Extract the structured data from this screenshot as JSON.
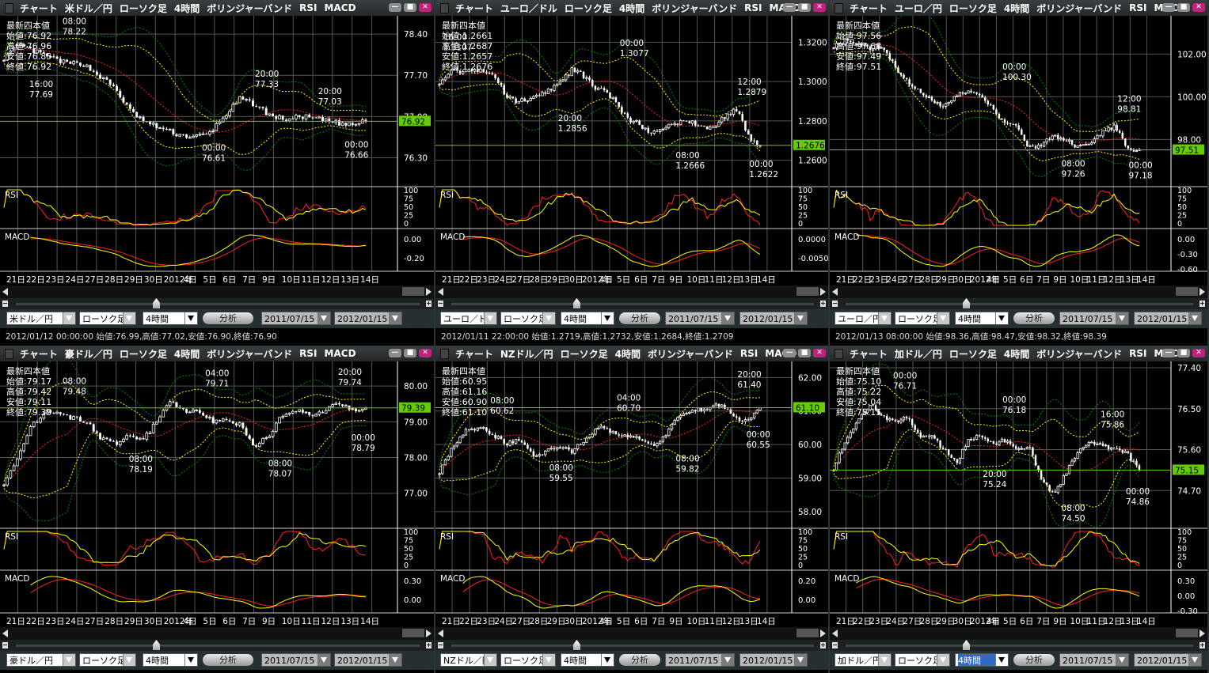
{
  "title_common": {
    "chart": "チャート",
    "type": "ローソク足",
    "interval": "4時間",
    "bb": "ボリンジャーバンド",
    "rsi": "RSI",
    "macd": "MACD"
  },
  "labels": {
    "latest": "最新四本値",
    "open": "始値:",
    "high": "高値:",
    "low": "安値:",
    "close": "終値:",
    "rsi": "RSI",
    "macd": "MACD",
    "analyze": "分析",
    "minimize": "—",
    "maximize": "■",
    "close_btn": "✕"
  },
  "colors": {
    "candle": "#ffffff",
    "bb_mid": "#ff2020",
    "bb_2s": "#ffff00",
    "bb_3s": "#008800",
    "current": "#66cc00",
    "rsi_a": "#ffff00",
    "rsi_b": "#ff2020",
    "macd": "#ffff00",
    "signal": "#ff2020",
    "grid": "#555555"
  },
  "date_labels": [
    "21日",
    "22日",
    "23日",
    "24日",
    "27日",
    "28日",
    "29日",
    "30日",
    "2012年",
    "4日",
    "5日",
    "6日",
    "7日",
    "9日",
    "10日",
    "11日",
    "12日",
    "13日",
    "14日"
  ],
  "rsi_ticks": [
    "100",
    "75",
    "50",
    "25",
    "0"
  ],
  "panels": [
    {
      "pair": "米ドル／円",
      "pair_select": "米ドル／円",
      "type_select": "ローソク足",
      "interval_select": "4時間",
      "interval_highlight": false,
      "date_from": "2011/07/15",
      "date_to": "2012/01/15",
      "ohlc": {
        "open": "76.92",
        "high": "76.96",
        "low": "76.85",
        "close": "76.92"
      },
      "current": "76.92",
      "ylim": [
        75.81,
        78.71
      ],
      "ticks": [
        "78.40",
        "77.70",
        "77.00",
        "76.30"
      ],
      "macd_ticks": [
        "0.00",
        "-0.20"
      ],
      "shape": [
        78.0,
        78.2,
        78.1,
        78.0,
        77.9,
        77.9,
        77.7,
        77.5,
        77.1,
        76.9,
        76.8,
        76.7,
        76.65,
        76.7,
        77.0,
        77.3,
        77.2,
        77.0,
        76.95,
        77.0,
        76.95,
        76.9,
        76.85,
        76.92
      ],
      "annotations": [
        {
          "time": "08:00",
          "price": "78.22",
          "at": 20,
          "kind": "high"
        },
        {
          "time": "16:00",
          "price": "77.69",
          "at": 10,
          "kind": "low"
        },
        {
          "time": "20:00",
          "price": "77.33",
          "at": 78,
          "kind": "high"
        },
        {
          "time": "20:00",
          "price": "77.03",
          "at": 97,
          "kind": "high"
        },
        {
          "time": "00:00",
          "price": "76.61",
          "at": 62,
          "kind": "low"
        },
        {
          "time": "00:00",
          "price": "76.66",
          "at": 105,
          "kind": "low"
        }
      ],
      "status": "2012/01/12 00:00:00 始値:76.99,高値:77.02,安値:76.90,終値:76.90"
    },
    {
      "pair": "ユーロ／ドル",
      "pair_select": "ユーロ／ドル",
      "type_select": "ローソク足",
      "interval_select": "4時間",
      "interval_highlight": false,
      "date_from": "2011/07/15",
      "date_to": "2012/01/15",
      "ohlc": {
        "open": "1.2661",
        "high": "1.2687",
        "low": "1.2657",
        "close": "1.2676"
      },
      "current": "1.2676",
      "ylim": [
        1.2466,
        1.3334
      ],
      "ticks": [
        "1.3200",
        "1.3000",
        "1.2800",
        "1.2600"
      ],
      "macd_ticks": [
        "0.0000",
        "-0.0050"
      ],
      "shape": [
        1.3,
        1.306,
        1.305,
        1.306,
        1.305,
        1.303,
        1.293,
        1.29,
        1.291,
        1.292,
        1.296,
        1.3,
        1.306,
        1.303,
        1.297,
        1.295,
        1.289,
        1.281,
        1.279,
        1.274,
        1.275,
        1.278,
        1.28,
        1.279,
        1.276,
        1.278,
        1.283,
        1.286,
        1.271,
        1.2676
      ],
      "annotations": [
        {
          "time": "16:00",
          "price": "1.3107",
          "at": 4,
          "kind": "high"
        },
        {
          "time": "00:00",
          "price": "1.3077",
          "at": 64,
          "kind": "high"
        },
        {
          "time": "20:00",
          "price": "1.2856",
          "at": 43,
          "kind": "low"
        },
        {
          "time": "08:00",
          "price": "1.2666",
          "at": 83,
          "kind": "low"
        },
        {
          "time": "12:00",
          "price": "1.2879",
          "at": 104,
          "kind": "high"
        },
        {
          "time": "00:00",
          "price": "1.2622",
          "at": 108,
          "kind": "low"
        }
      ],
      "status": "2012/01/11 22:00:00 始値:1.2719,高値:1.2732,安値:1.2684,終値:1.2709"
    },
    {
      "pair": "ユーロ／円",
      "pair_select": "ユーロ／円",
      "type_select": "ローソク足",
      "interval_select": "4時間",
      "interval_highlight": false,
      "date_from": "2011/07/15",
      "date_to": "2012/01/15",
      "ohlc": {
        "open": "97.56",
        "high": "97.68",
        "low": "97.49",
        "close": "97.51"
      },
      "current": "97.51",
      "ylim": [
        95.79,
        103.79
      ],
      "ticks": [
        "102.00",
        "100.00",
        "98.00"
      ],
      "macd_ticks": [
        "0.00",
        "-0.30",
        "-0.60"
      ],
      "shape": [
        102.4,
        102.6,
        102.5,
        102.3,
        102.4,
        101.4,
        100.7,
        100.3,
        99.8,
        99.5,
        100.0,
        100.3,
        100.0,
        99.4,
        98.8,
        98.6,
        97.6,
        97.8,
        98.1,
        98.0,
        97.6,
        97.8,
        98.4,
        98.6,
        97.6,
        97.51
      ],
      "annotations": [
        {
          "time": "00:00",
          "price": "100.30",
          "at": 63,
          "kind": "high"
        },
        {
          "time": "08:00",
          "price": "97.26",
          "at": 84,
          "kind": "low"
        },
        {
          "time": "12:00",
          "price": "98.81",
          "at": 104,
          "kind": "high"
        },
        {
          "time": "00:00",
          "price": "97.18",
          "at": 108,
          "kind": "low"
        }
      ],
      "status": "2012/01/13 08:00:00 始値:98.36,高値:98.47,安値:98.32,終値:98.39"
    },
    {
      "pair": "豪ドル／円",
      "pair_select": "豪ドル／円",
      "type_select": "ローソク足",
      "interval_select": "4時間",
      "interval_highlight": false,
      "date_from": "2011/07/15",
      "date_to": "2012/01/15",
      "ohlc": {
        "open": "79.17",
        "high": "79.42",
        "low": "79.11",
        "close": "79.39"
      },
      "current": "79.39",
      "ylim": [
        76.02,
        80.69
      ],
      "ticks": [
        "80.00",
        "79.00",
        "78.00",
        "77.00"
      ],
      "macd_ticks": [
        "0.30",
        "0.00"
      ],
      "shape": [
        77.3,
        78.0,
        78.9,
        79.3,
        79.2,
        79.1,
        79.0,
        78.5,
        78.4,
        78.6,
        78.5,
        79.0,
        79.6,
        79.3,
        79.3,
        79.0,
        79.1,
        78.9,
        78.3,
        78.6,
        79.2,
        79.3,
        79.2,
        79.3,
        79.5,
        79.3,
        79.39
      ],
      "annotations": [
        {
          "time": "08:00",
          "price": "79.48",
          "at": 20,
          "kind": "high"
        },
        {
          "time": "04:00",
          "price": "79.71",
          "at": 63,
          "kind": "high"
        },
        {
          "time": "20:00",
          "price": "79.74",
          "at": 103,
          "kind": "high"
        },
        {
          "time": "08:00",
          "price": "78.19",
          "at": 40,
          "kind": "low"
        },
        {
          "time": "08:00",
          "price": "78.07",
          "at": 82,
          "kind": "low"
        },
        {
          "time": "00:00",
          "price": "78.79",
          "at": 107,
          "kind": "low"
        }
      ]
    },
    {
      "pair": "NZドル／円",
      "pair_select": "NZドル／円",
      "type_select": "ローソク足",
      "interval_select": "4時間",
      "interval_highlight": false,
      "date_from": "2011/07/15",
      "date_to": "2012/01/15",
      "ohlc": {
        "open": "60.95",
        "high": "61.16",
        "low": "60.90",
        "close": "61.10"
      },
      "current": "61.10",
      "ylim": [
        57.5,
        62.48
      ],
      "ticks": [
        "62.00",
        "61.00",
        "60.00",
        "59.00",
        "58.00"
      ],
      "macd_ticks": [
        "0.20",
        "0.00"
      ],
      "shape": [
        59.2,
        59.9,
        60.4,
        60.5,
        60.3,
        60.0,
        60.2,
        59.7,
        59.8,
        59.9,
        59.8,
        60.2,
        60.5,
        60.4,
        60.2,
        60.2,
        60.0,
        60.3,
        60.9,
        61.0,
        61.1,
        61.2,
        60.8,
        60.7,
        61.1
      ],
      "annotations": [
        {
          "time": "08:00",
          "price": "60.62",
          "at": 20,
          "kind": "high"
        },
        {
          "time": "04:00",
          "price": "60.70",
          "at": 63,
          "kind": "high"
        },
        {
          "time": "20:00",
          "price": "61.40",
          "at": 104,
          "kind": "high"
        },
        {
          "time": "08:00",
          "price": "59.55",
          "at": 40,
          "kind": "low"
        },
        {
          "time": "08:00",
          "price": "59.82",
          "at": 83,
          "kind": "low"
        },
        {
          "time": "00:00",
          "price": "60.55",
          "at": 107,
          "kind": "low"
        }
      ]
    },
    {
      "pair": "加ドル／円",
      "pair_select": "加ドル／円",
      "type_select": "ローソク足",
      "interval_select": "4時間",
      "interval_highlight": true,
      "date_from": "2011/07/15",
      "date_to": "2012/01/15",
      "ohlc": {
        "open": "75.10",
        "high": "75.22",
        "low": "75.04",
        "close": "75.15"
      },
      "current": "75.15",
      "ylim": [
        73.87,
        77.54
      ],
      "ticks": [
        "77.40",
        "76.50",
        "75.60",
        "74.70"
      ],
      "macd_ticks": [
        "0.30",
        "0.00",
        "-0.30"
      ],
      "shape": [
        75.2,
        75.8,
        76.3,
        76.6,
        76.3,
        76.2,
        76.3,
        75.9,
        75.9,
        75.6,
        75.3,
        75.8,
        75.9,
        75.7,
        75.8,
        75.6,
        75.7,
        74.9,
        74.6,
        75.1,
        75.6,
        75.8,
        75.7,
        75.6,
        75.5,
        75.15
      ],
      "annotations": [
        {
          "time": "00:00",
          "price": "76.71",
          "at": 24,
          "kind": "high"
        },
        {
          "time": "00:00",
          "price": "76.18",
          "at": 63,
          "kind": "high"
        },
        {
          "time": "16:00",
          "price": "75.86",
          "at": 98,
          "kind": "high"
        },
        {
          "time": "20:00",
          "price": "75.24",
          "at": 56,
          "kind": "low"
        },
        {
          "time": "08:00",
          "price": "74.50",
          "at": 84,
          "kind": "low"
        },
        {
          "time": "00:00",
          "price": "74.86",
          "at": 107,
          "kind": "low"
        }
      ]
    }
  ]
}
